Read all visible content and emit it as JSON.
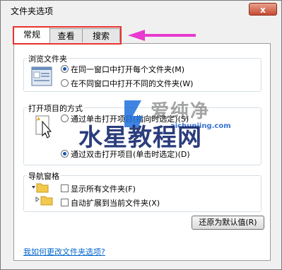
{
  "window": {
    "title": "文件夹选项",
    "close_glyph": "x"
  },
  "tabs": [
    {
      "label": "常规",
      "active": true
    },
    {
      "label": "查看",
      "active": false
    },
    {
      "label": "搜索",
      "active": false
    }
  ],
  "browse": {
    "title": "浏览文件夹",
    "options": [
      {
        "label": "在同一窗口中打开每个文件夹(M)",
        "selected": true
      },
      {
        "label": "在不同窗口中打开不同的文件夹(W)",
        "selected": false
      }
    ]
  },
  "click": {
    "title": "打开项目的方式",
    "options": [
      {
        "label": "通过单击打开项目(指向时选定)(S)",
        "selected": false
      },
      {
        "label": "通过双击打开项目(单击时选定)(D)",
        "selected": true
      }
    ]
  },
  "nav": {
    "title": "导航窗格",
    "options": [
      {
        "label": "显示所有文件夹(F)",
        "checked": false
      },
      {
        "label": "自动扩展到当前文件夹(X)",
        "checked": false
      }
    ]
  },
  "restore_button": "还原为默认值(R)",
  "help_link": "我如何更改文件夹选项?",
  "watermark": {
    "brand_cn": "爱纯净",
    "brand_url": "aichunjing.com",
    "overlay": "水星教程网"
  },
  "colors": {
    "highlight_border": "#e8322e",
    "arrow": "#e83ad0",
    "link": "#0066cc"
  }
}
